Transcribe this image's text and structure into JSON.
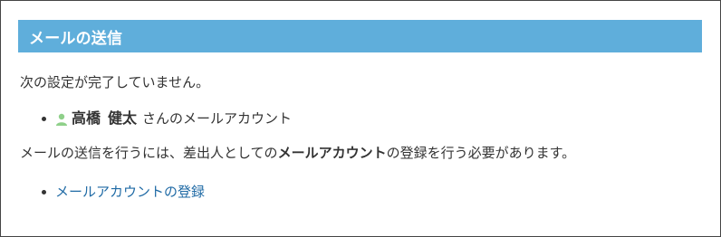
{
  "header": {
    "title": "メールの送信"
  },
  "notice": {
    "text": "次の設定が完了していません。"
  },
  "pending_item": {
    "icon": "user-icon",
    "icon_color": "#8fd08a",
    "family_name": "高橋",
    "given_name": "健太",
    "suffix": "さんのメールアカウント"
  },
  "explanation": {
    "before": "メールの送信を行うには、差出人としての",
    "emphasis": "メールアカウント",
    "after": "の登録を行う必要があります。"
  },
  "action": {
    "link_label": "メールアカウントの登録"
  },
  "colors": {
    "header_bg": "#5faedb",
    "link": "#1f6aa5"
  }
}
